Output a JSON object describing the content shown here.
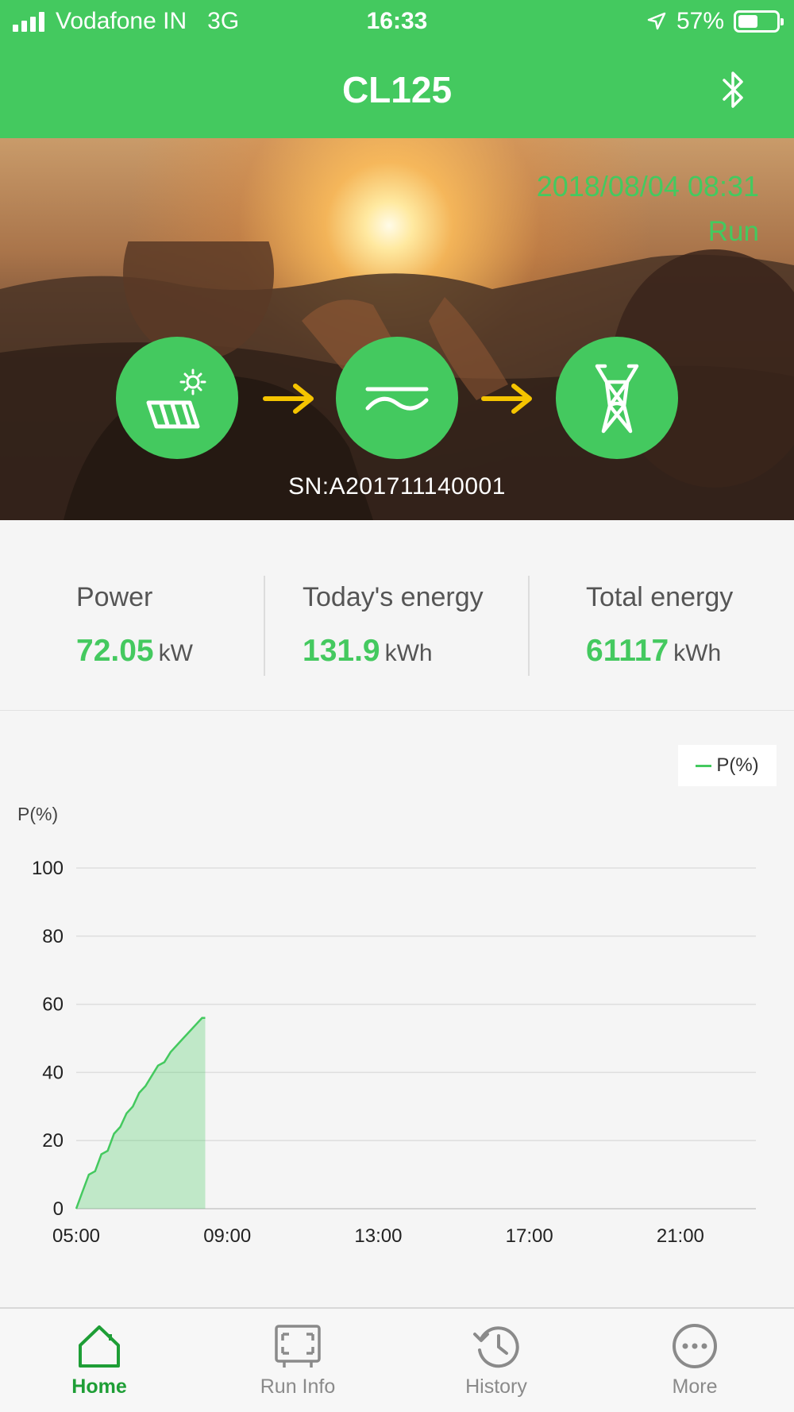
{
  "status_bar": {
    "carrier": "Vodafone IN",
    "network": "3G",
    "time": "16:33",
    "battery": "57%",
    "battery_level": 0.57
  },
  "header": {
    "title": "CL125",
    "bluetooth_icon": "bluetooth-icon"
  },
  "hero": {
    "datetime": "2018/08/04 08:31",
    "status": "Run",
    "serial": "SN:A201711140001",
    "flow": [
      {
        "icon": "solar-panel-icon"
      },
      {
        "icon": "arrow-right-icon"
      },
      {
        "icon": "inverter-wave-icon"
      },
      {
        "icon": "arrow-right-icon"
      },
      {
        "icon": "grid-tower-icon"
      }
    ]
  },
  "stats": [
    {
      "label": "Power",
      "value": "72.05",
      "unit": "kW"
    },
    {
      "label": "Today's energy",
      "value": "131.9",
      "unit": "kWh"
    },
    {
      "label": "Total energy",
      "value": "61117",
      "unit": "kWh"
    }
  ],
  "chart_data": {
    "type": "area",
    "title": "",
    "xlabel": "",
    "ylabel": "P(%)",
    "legend": [
      "P(%)"
    ],
    "legend_position": "top-right",
    "grid": true,
    "ylim": [
      0,
      100
    ],
    "xlim": [
      "05:00",
      "23:00"
    ],
    "yticks": [
      "0",
      "20",
      "40",
      "60",
      "80",
      "100"
    ],
    "xticks": [
      "05:00",
      "09:00",
      "13:00",
      "17:00",
      "21:00"
    ],
    "series": [
      {
        "name": "P(%)",
        "x": [
          "05:00",
          "05:10",
          "05:20",
          "05:30",
          "05:40",
          "05:50",
          "06:00",
          "06:10",
          "06:20",
          "06:30",
          "06:40",
          "06:50",
          "07:00",
          "07:10",
          "07:20",
          "07:30",
          "07:40",
          "07:50",
          "08:00",
          "08:10",
          "08:20",
          "08:25"
        ],
        "values": [
          0,
          5,
          10,
          11,
          16,
          17,
          22,
          24,
          28,
          30,
          34,
          36,
          39,
          42,
          43,
          46,
          48,
          50,
          52,
          54,
          56,
          56
        ]
      }
    ]
  },
  "tabs": [
    {
      "label": "Home",
      "icon": "home-icon",
      "active": true
    },
    {
      "label": "Run Info",
      "icon": "run-info-icon",
      "active": false
    },
    {
      "label": "History",
      "icon": "history-icon",
      "active": false
    },
    {
      "label": "More",
      "icon": "more-icon",
      "active": false
    }
  ],
  "colors": {
    "accent": "#44c95f",
    "arrow": "#f5c400",
    "tab_active": "#1e9e36"
  }
}
